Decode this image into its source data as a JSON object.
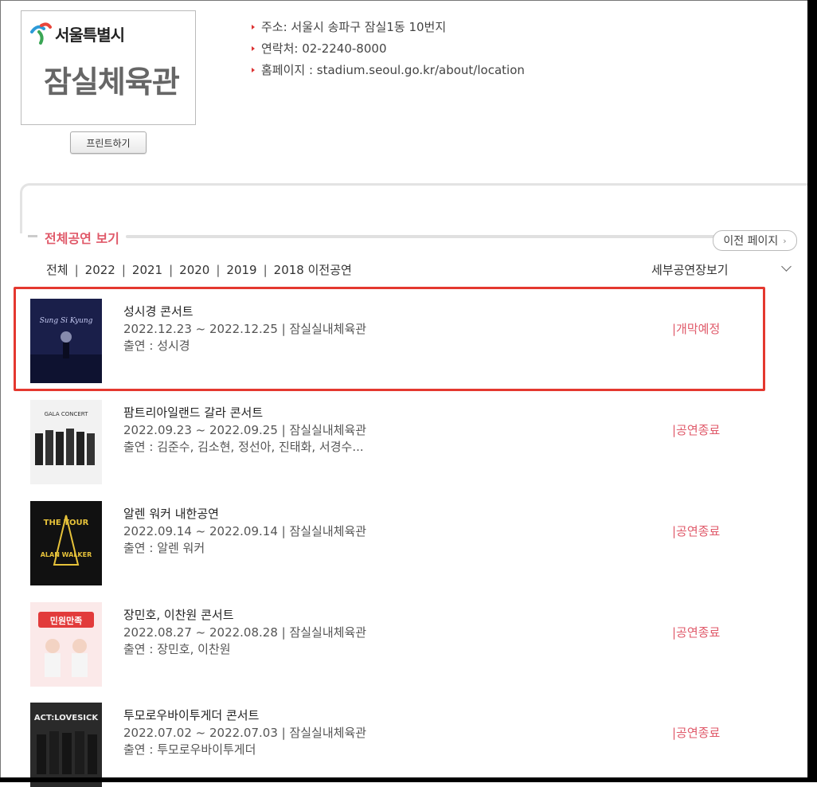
{
  "venue": {
    "logo_city": "서울특별시",
    "logo_name": "잠실체육관",
    "print_label": "프린트하기",
    "info": [
      {
        "text": "주소: 서울시 송파구 잠실1동 10번지"
      },
      {
        "text": "연락처: 02-2240-8000"
      },
      {
        "text": "홈페이지 : stadium.seoul.go.kr/about/location"
      }
    ]
  },
  "section": {
    "title": "전체공연 보기",
    "prev_page_label": "이전 페이지"
  },
  "filters": {
    "years": [
      "전체",
      "2022",
      "2021",
      "2020",
      "2019",
      "2018 이전공연"
    ],
    "detail_select": "세부공연장보기"
  },
  "events": [
    {
      "title": "성시경 콘서트",
      "date": "2022.12.23 ~ 2022.12.25 | 잠실실내체육관",
      "cast": "출연 : 성시경",
      "status": "|개막예정",
      "poster_text": "Sung Si Kyung",
      "poster_color": "#1a1f4a"
    },
    {
      "title": "팜트리아일랜드 갈라 콘서트",
      "date": "2022.09.23 ~ 2022.09.25 | 잠실실내체육관",
      "cast": "출연 : 김준수, 김소현, 정선아, 진태화, 서경수...",
      "status": "|공연종료",
      "poster_text": "GALA CONCERT",
      "poster_color": "#f2f2f2"
    },
    {
      "title": "알렌 워커 내한공연",
      "date": "2022.09.14 ~ 2022.09.14 | 잠실실내체육관",
      "cast": "출연 : 알렌 워커",
      "status": "|공연종료",
      "poster_text": "ALAN WALKER",
      "poster_color": "#111111"
    },
    {
      "title": "장민호, 이찬원 콘서트",
      "date": "2022.08.27 ~ 2022.08.28 | 잠실실내체육관",
      "cast": "출연 : 장민호, 이찬원",
      "status": "|공연종료",
      "poster_text": "민원만족",
      "poster_color": "#fbe9e9"
    },
    {
      "title": "투모로우바이투게더 콘서트",
      "date": "2022.07.02 ~ 2022.07.03 | 잠실실내체육관",
      "cast": "출연 : 투모로우바이투게더",
      "status": "|공연종료",
      "poster_text": "ACT:LOVESICK",
      "poster_color": "#2a2a2a"
    }
  ]
}
